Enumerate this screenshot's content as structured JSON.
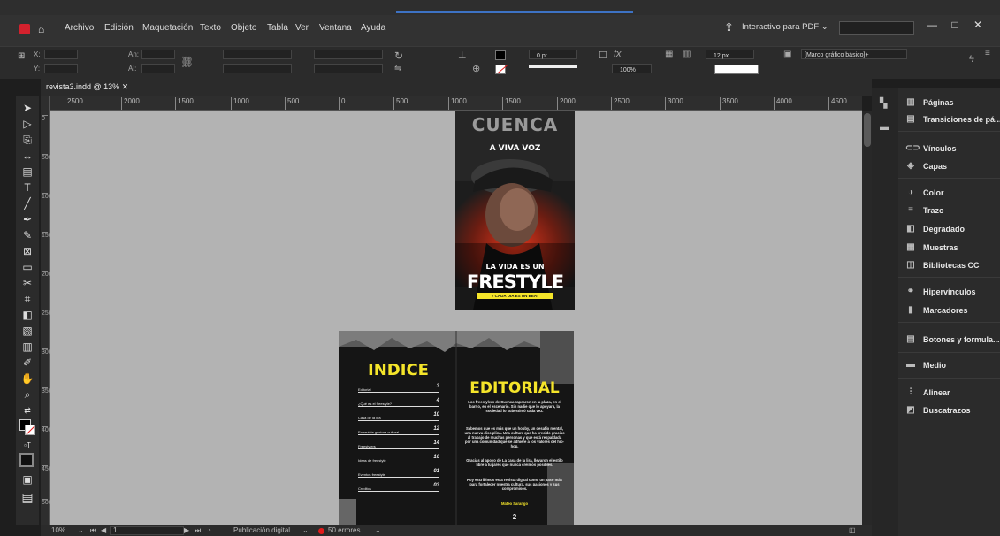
{
  "menubar": {
    "items": [
      "Archivo",
      "Edición",
      "Maquetación",
      "Texto",
      "Objeto",
      "Tabla",
      "Ver",
      "Ventana",
      "Ayuda"
    ],
    "workspace": "Interactivo para PDF",
    "minimize": "—",
    "maximize": "□",
    "close": "✕"
  },
  "control": {
    "x_label": "X:",
    "y_label": "Y:",
    "w_label": "An:",
    "h_label": "Al:",
    "stroke_weight": "0 pt",
    "opacity": "100%",
    "size": "12 px",
    "frame_style": "[Marco gráfico básico]+"
  },
  "document": {
    "tab_label": "revista3.indd @ 13%",
    "tab_close": "✕"
  },
  "ruler": {
    "ticks": [
      "2500",
      "2000",
      "1500",
      "1000",
      "500",
      "0",
      "500",
      "1000",
      "1500",
      "2000",
      "2500",
      "3000",
      "3500",
      "4000",
      "4500"
    ],
    "vticks": [
      "0",
      "500",
      "1000",
      "1500",
      "2000",
      "2500",
      "3000",
      "3500",
      "4000",
      "4500",
      "5000"
    ]
  },
  "status": {
    "zoom": "10%",
    "page": "1",
    "preflight_profile": "Publicación digital",
    "errors": "50 errores"
  },
  "panels": {
    "items": [
      "Páginas",
      "Transiciones de pá...",
      "Vínculos",
      "Capas",
      "Color",
      "Trazo",
      "Degradado",
      "Muestras",
      "Bibliotecas CC",
      "Hipervínculos",
      "Marcadores",
      "Botones y formula...",
      "Medio",
      "Alinear",
      "Buscatrazos"
    ]
  },
  "cover": {
    "title": "CUENCA",
    "subtitle": "A VIVA VOZ",
    "line1": "LA VIDA ES UN",
    "headline": "FRESTYLE",
    "tagline": "Y CADA DIA ES UN BEAT"
  },
  "index_page": {
    "title": "INDICE",
    "entries": [
      {
        "label": "Editorial",
        "page": "3"
      },
      {
        "label": "¿Qué es el freestyle?",
        "page": "4"
      },
      {
        "label": "Casa de la lira",
        "page": "10"
      },
      {
        "label": "Entrevista gestora cultural",
        "page": "12"
      },
      {
        "label": "Freestylers",
        "page": "14"
      },
      {
        "label": "Ideas de freestyle",
        "page": "16"
      },
      {
        "label": "Eventos freestyle",
        "page": "01"
      },
      {
        "label": "Créditos",
        "page": "03"
      }
    ]
  },
  "editorial": {
    "title": "EDITORIAL",
    "p1": "Los freestylers de Cuenca rapearon en la plaza, en el barrio, en el escenario. Sin nadie que lo apoyara, la sociedad lo subestimó cada vez.",
    "p2": "Sabemos que es más que un hobby, un desafío mental, una nueva disciplina. Una cultura que ha crecido gracias al trabajo de muchas personas y que está respaldada por una comunidad que se adhiere a los valores del hip-hop.",
    "p3": "Gracias al apoyo de La casa de la lira, llevaron el estilo libre a lugares que nunca creímos posibles.",
    "p4": "Hoy escribimos esta revista digital como un paso más para fortalecer nuestra cultura, sus pasiones y sus compromisos.",
    "author": "Mateo Sarango",
    "page_number": "2"
  },
  "colors": {
    "accent_yellow": "#f5e52a",
    "error_red": "#e21b1b",
    "app_red": "#d4212d"
  }
}
